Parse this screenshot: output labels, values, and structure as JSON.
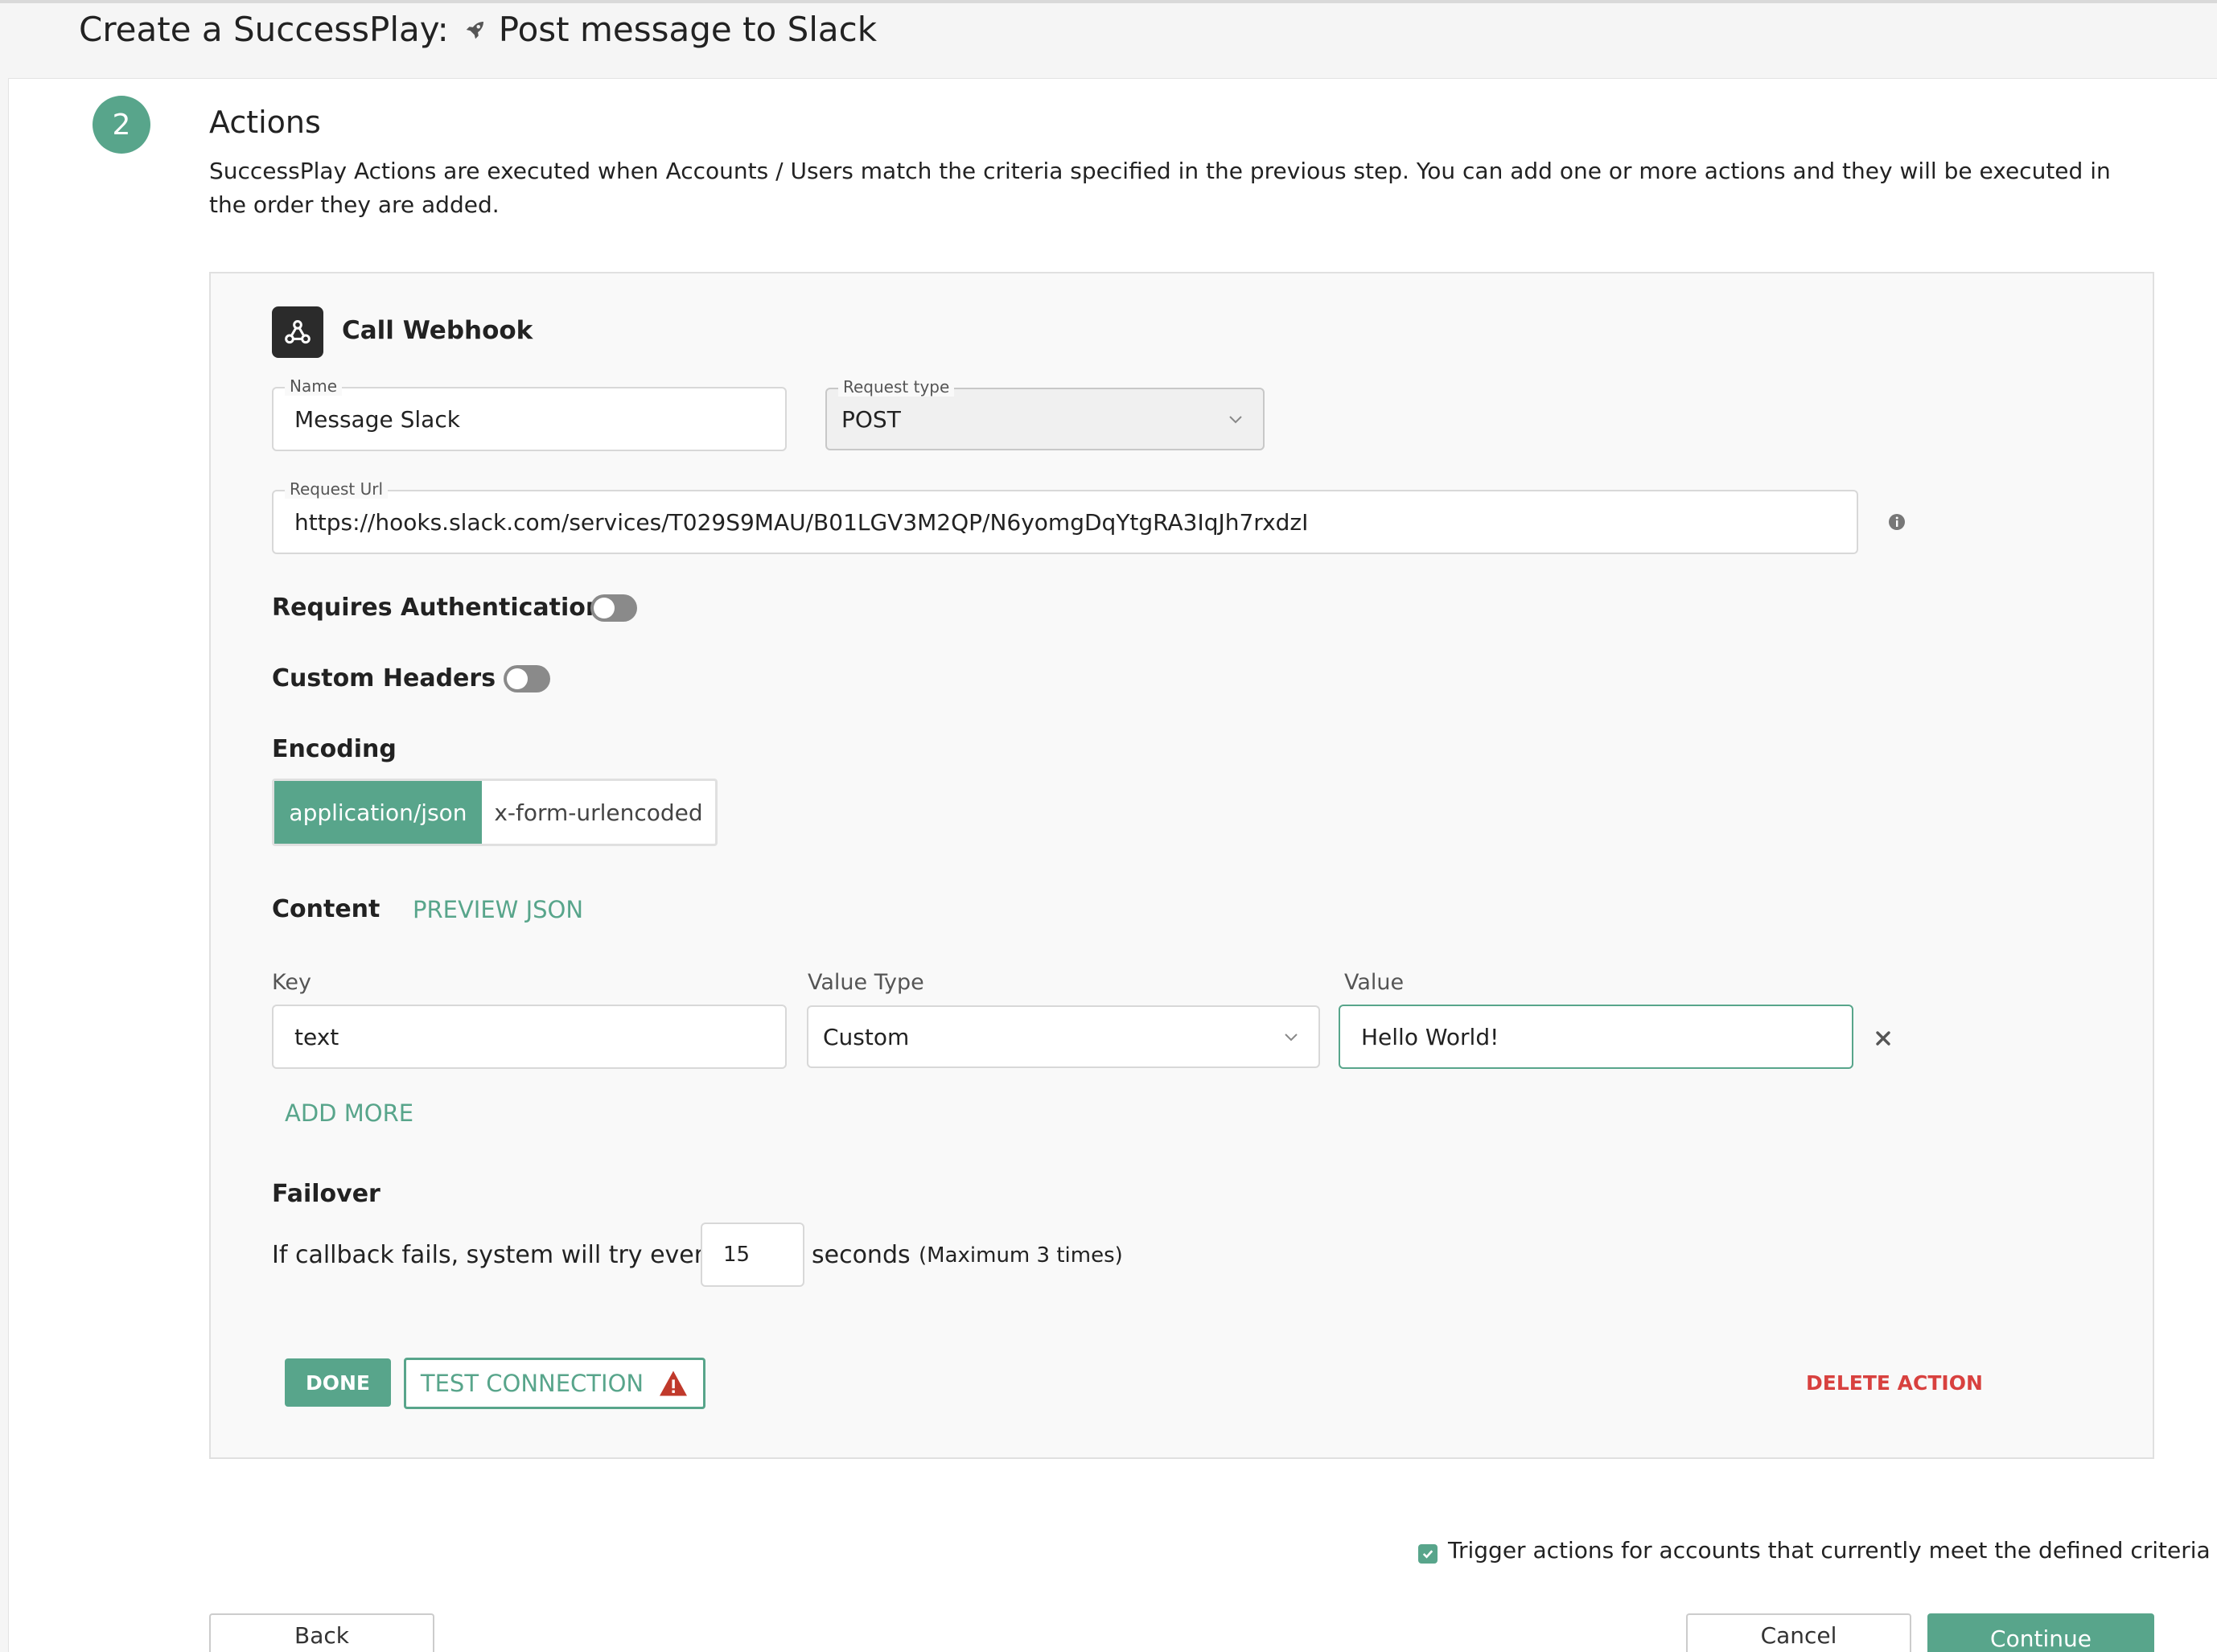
{
  "page": {
    "title_prefix": "Create a SuccessPlay:",
    "title_name": "Post message to Slack",
    "title_icon": "rocket-icon"
  },
  "step": {
    "number": "2",
    "title": "Actions",
    "description": "SuccessPlay Actions are executed when Accounts / Users match the criteria specified in the previous step. You can add one or more actions and they will be executed in the order they are added."
  },
  "action": {
    "title": "Call Webhook",
    "icon": "webhook-icon",
    "name_label": "Name",
    "name_value": "Message Slack",
    "request_type_label": "Request type",
    "request_type_value": "POST",
    "request_url_label": "Request Url",
    "request_url_value": "https://hooks.slack.com/services/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",
    "requires_auth_label": "Requires Authentication",
    "requires_auth_on": false,
    "custom_headers_label": "Custom Headers",
    "custom_headers_on": false,
    "encoding_label": "Encoding",
    "encoding_options": [
      "application/json",
      "x-form-urlencoded"
    ],
    "encoding_selected": "application/json",
    "content_label": "Content",
    "preview_json_label": "PREVIEW JSON",
    "columns": {
      "key": "Key",
      "value_type": "Value Type",
      "value": "Value"
    },
    "rows": [
      {
        "key": "text",
        "value_type": "Custom",
        "value": "Hello World!"
      }
    ],
    "add_more_label": "ADD MORE",
    "failover_label": "Failover",
    "failover_prefix": "If callback fails, system will try every",
    "failover_seconds": "15",
    "failover_suffix": "seconds",
    "failover_note": "(Maximum 3 times)",
    "done_label": "DONE",
    "test_connection_label": "TEST CONNECTION",
    "delete_label": "DELETE ACTION"
  },
  "trigger": {
    "checked": true,
    "label": "Trigger actions for accounts that currently meet the defined criteria"
  },
  "footer": {
    "back_label": "Back",
    "cancel_label": "Cancel",
    "continue_label": "Continue"
  },
  "colors": {
    "accent": "#58a58b",
    "danger": "#d8413f",
    "warning": "#c0392b"
  }
}
